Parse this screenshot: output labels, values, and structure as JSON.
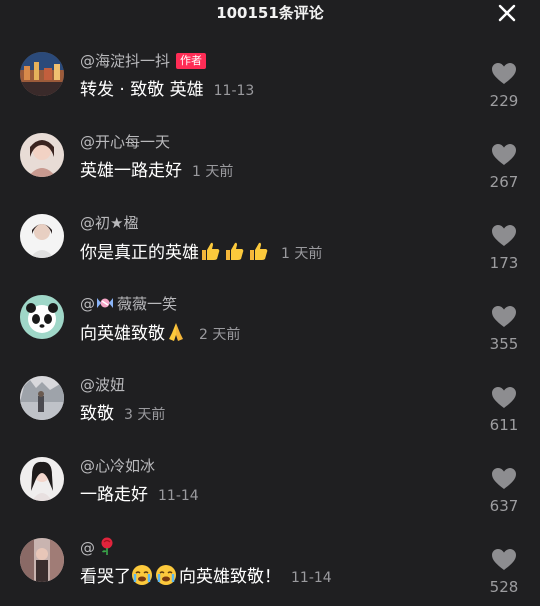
{
  "header": {
    "title": "100151条评论"
  },
  "comments": [
    {
      "username": "@海淀抖一抖",
      "badge": "作者",
      "text": "转发 · 致敬 英雄",
      "date": "11-13",
      "likes": "229"
    },
    {
      "username": "@开心每一天",
      "text": "英雄一路走好",
      "date": "1 天前",
      "likes": "267"
    },
    {
      "username": "@初★楹",
      "text": "你是真正的英雄",
      "emoji_after": [
        "thumbs-up",
        "thumbs-up",
        "thumbs-up"
      ],
      "date": "1 天前",
      "likes": "173"
    },
    {
      "username_prefix": "@",
      "username_emoji": "candy",
      "username": "薇薇一笑",
      "text": "向英雄致敬",
      "emoji_after": [
        "folded-hands"
      ],
      "date": "2 天前",
      "likes": "355"
    },
    {
      "username": "@波妞",
      "text": "致敬",
      "date": "3 天前",
      "likes": "611"
    },
    {
      "username": "@心冷如冰",
      "text": "一路走好",
      "date": "11-14",
      "likes": "637"
    },
    {
      "username": "@",
      "username_emoji": "rose",
      "text_before": "看哭了",
      "text_after": "向英雄致敬！",
      "emoji_middle": [
        "crying-face",
        "crying-face"
      ],
      "date": "11-14",
      "likes": "528"
    }
  ],
  "colors": {
    "background": "#1f1f21",
    "badge": "#fe2c55",
    "username": "#b9b9bc",
    "meta": "#9a9a9e"
  }
}
